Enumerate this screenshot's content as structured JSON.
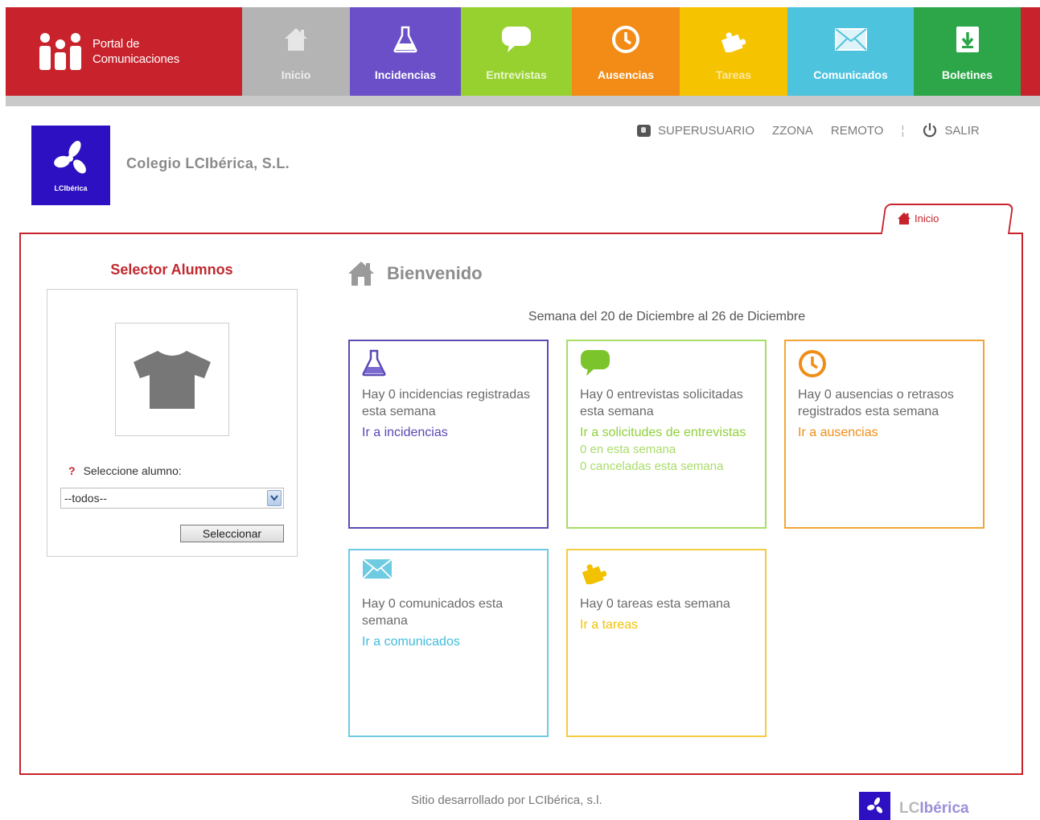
{
  "nav": {
    "brand_line1": "Portal de",
    "brand_line2": "Comunicaciones",
    "items": [
      {
        "label": "Inicio",
        "icon": "home-icon"
      },
      {
        "label": "Incidencias",
        "icon": "flask-icon"
      },
      {
        "label": "Entrevistas",
        "icon": "speech-bubble-icon"
      },
      {
        "label": "Ausencias",
        "icon": "clock-icon"
      },
      {
        "label": "Tareas",
        "icon": "puzzle-icon"
      },
      {
        "label": "Comunicados",
        "icon": "envelope-icon"
      },
      {
        "label": "Boletines",
        "icon": "download-icon"
      }
    ]
  },
  "header": {
    "logo_text": "LCIbérica",
    "school_name": "Colegio LCIbérica, S.L.",
    "user": "SUPERUSUARIO",
    "zone": "ZZONA",
    "mode": "REMOTO",
    "separator": "¦",
    "logout": "SALIR"
  },
  "tab": {
    "label": "Inicio"
  },
  "selector": {
    "title": "Selector Alumnos",
    "help": "?",
    "label": "Seleccione alumno:",
    "selected": "--todos--",
    "button": "Seleccionar"
  },
  "main": {
    "welcome": "Bienvenido",
    "week": "Semana del 20 de Diciembre al 26 de Diciembre",
    "cards": [
      {
        "text": "Hay 0 incidencias registradas esta semana",
        "link": "Ir a incidencias",
        "color": "#5a47b5"
      },
      {
        "text": "Hay 0 entrevistas solicitadas esta semana",
        "link": "Ir a solicitudes de entrevistas",
        "note1": "0 en esta semana",
        "note2": "0 canceladas esta semana",
        "color": "#8fd13a"
      },
      {
        "text": "Hay 0 ausencias o retrasos registrados esta semana",
        "link": "Ir a ausencias",
        "color": "#ef8d17"
      },
      {
        "text": "Hay 0 comunicados esta semana",
        "link": "Ir a comunicados",
        "color": "#3fbcdc"
      },
      {
        "text": "Hay 0 tareas esta semana",
        "link": "Ir a tareas",
        "color": "#f2c200"
      }
    ]
  },
  "footer": {
    "credit": "Sitio desarrollado por LCIbérica, s.l.",
    "brand_a": "LC",
    "brand_b": "Ibérica"
  }
}
